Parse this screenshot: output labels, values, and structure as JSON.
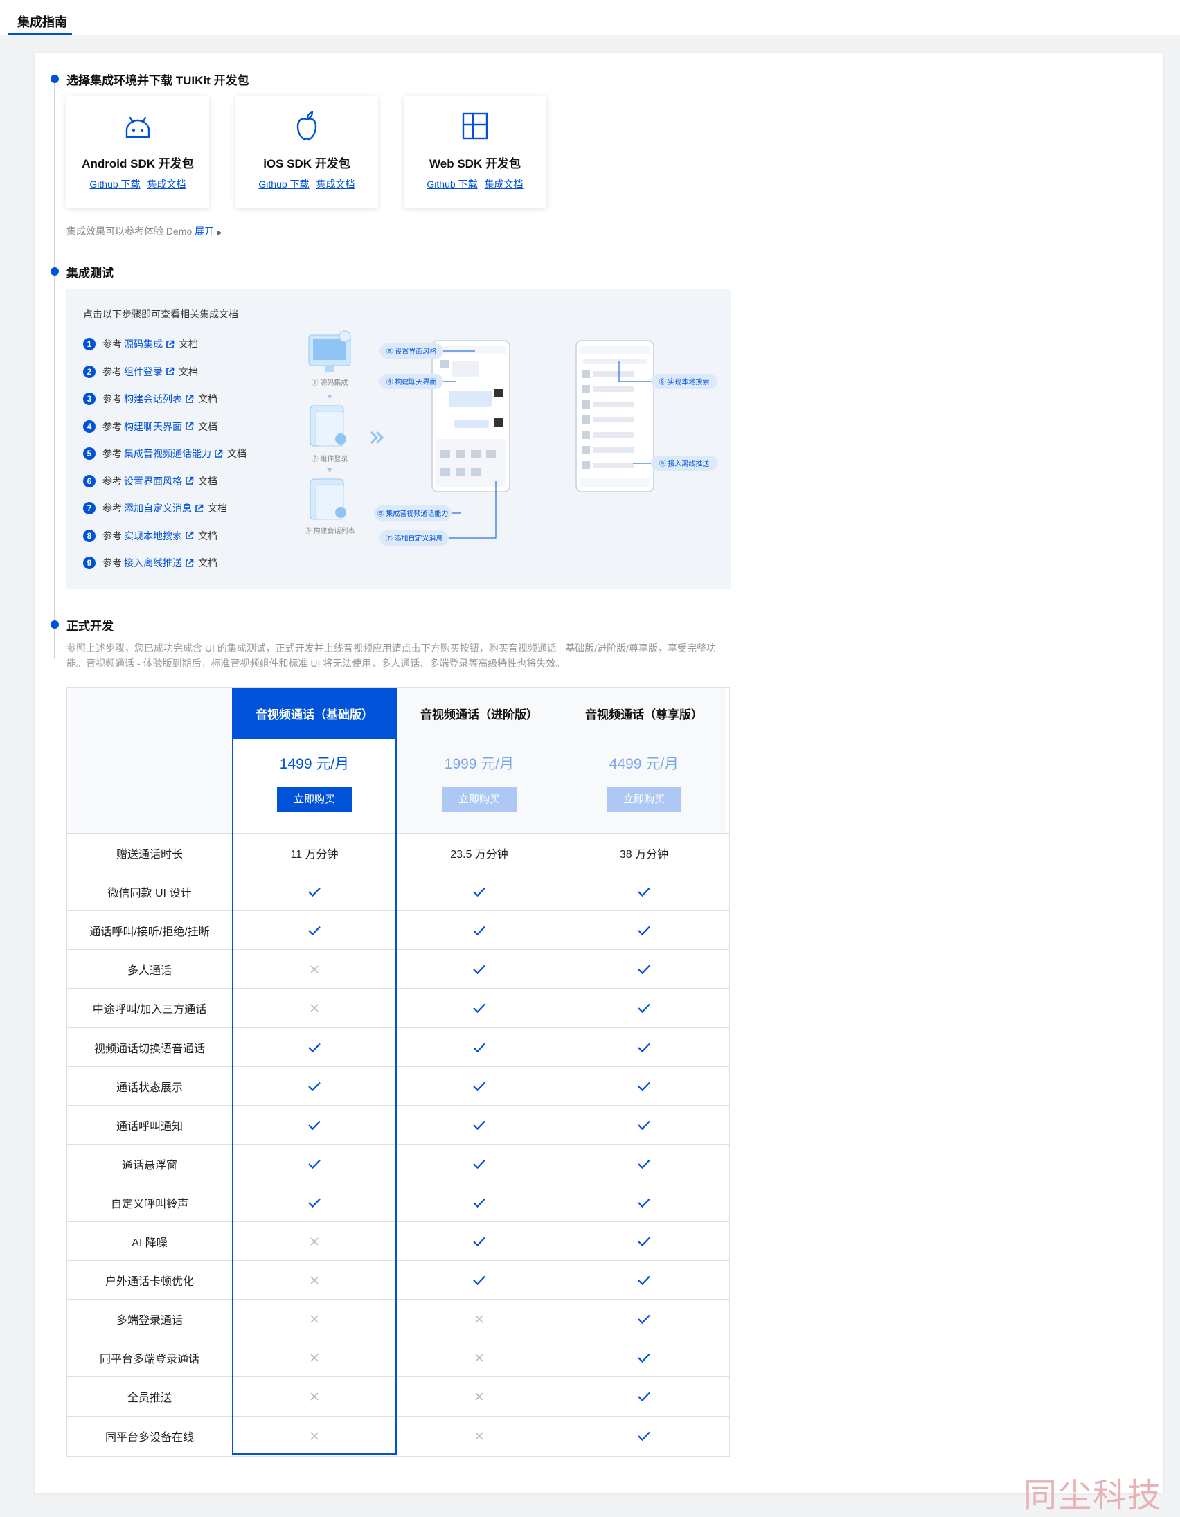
{
  "tab": "集成指南",
  "sections": {
    "s1": "选择集成环境并下载 TUIKit 开发包",
    "s2": "集成测试",
    "s3": "正式开发"
  },
  "sdks": [
    {
      "name": "Android SDK 开发包",
      "icon": "android-icon",
      "github": "Github 下载",
      "docs": "集成文档"
    },
    {
      "name": "iOS SDK 开发包",
      "icon": "apple-icon",
      "github": "Github 下载",
      "docs": "集成文档"
    },
    {
      "name": "Web SDK 开发包",
      "icon": "windows-icon",
      "github": "Github 下载",
      "docs": "集成文档"
    }
  ],
  "demo_note": "集成效果可以参考体验 Demo",
  "demo_expand": "展开",
  "guide": {
    "header": "点击以下步骤即可查看相关集成文档",
    "prefix": "参考",
    "suffix": "文档",
    "steps": [
      {
        "n": "1",
        "link": "源码集成"
      },
      {
        "n": "2",
        "link": "组件登录"
      },
      {
        "n": "3",
        "link": "构建会话列表"
      },
      {
        "n": "4",
        "link": "构建聊天界面"
      },
      {
        "n": "5",
        "link": "集成音视频通话能力"
      },
      {
        "n": "6",
        "link": "设置界面风格"
      },
      {
        "n": "7",
        "link": "添加自定义消息"
      },
      {
        "n": "8",
        "link": "实现本地搜索"
      },
      {
        "n": "9",
        "link": "接入离线推送"
      }
    ],
    "diagram_labels": {
      "a": "① 源码集成",
      "b": "② 组件登录",
      "c": "③ 构建会话列表",
      "d": "⑥ 设置界面风格",
      "e": "④ 构建聊天界面",
      "f": "⑤ 集成音视频通话能力",
      "g": "⑦ 添加自定义消息",
      "h": "⑧ 实现本地搜索",
      "i": "⑨ 接入离线推送"
    }
  },
  "description": "参照上述步骤，您已成功完成含 UI 的集成测试，正式开发并上线音视频应用请点击下方购买按钮，购买音视频通话 - 基础版/进阶版/尊享版，享受完整功能。音视频通话 - 体验版到期后，标准音视频组件和标准 UI 将无法使用，多人通话、多端登录等高级特性也将失效。",
  "plans": [
    {
      "name": "音视频通话（基础版）",
      "price": "1499 元/月",
      "buy": "立即购买",
      "active": true
    },
    {
      "name": "音视频通话（进阶版）",
      "price": "1999 元/月",
      "buy": "立即购买",
      "active": false
    },
    {
      "name": "音视频通话（尊享版）",
      "price": "4499 元/月",
      "buy": "立即购买",
      "active": false
    }
  ],
  "features": [
    {
      "name": "赠送通话时长",
      "values": [
        "11 万分钟",
        "23.5 万分钟",
        "38 万分钟"
      ]
    },
    {
      "name": "微信同款 UI 设计",
      "values": [
        true,
        true,
        true
      ]
    },
    {
      "name": "通话呼叫/接听/拒绝/挂断",
      "values": [
        true,
        true,
        true
      ]
    },
    {
      "name": "多人通话",
      "values": [
        false,
        true,
        true
      ]
    },
    {
      "name": "中途呼叫/加入三方通话",
      "values": [
        false,
        true,
        true
      ]
    },
    {
      "name": "视频通话切换语音通话",
      "values": [
        true,
        true,
        true
      ]
    },
    {
      "name": "通话状态展示",
      "values": [
        true,
        true,
        true
      ]
    },
    {
      "name": "通话呼叫通知",
      "values": [
        true,
        true,
        true
      ]
    },
    {
      "name": "通话悬浮窗",
      "values": [
        true,
        true,
        true
      ]
    },
    {
      "name": "自定义呼叫铃声",
      "values": [
        true,
        true,
        true
      ]
    },
    {
      "name": "AI 降噪",
      "values": [
        false,
        true,
        true
      ]
    },
    {
      "name": "户外通话卡顿优化",
      "values": [
        false,
        true,
        true
      ]
    },
    {
      "name": "多端登录通话",
      "values": [
        false,
        false,
        true
      ]
    },
    {
      "name": "同平台多端登录通话",
      "values": [
        false,
        false,
        true
      ]
    },
    {
      "name": "全员推送",
      "values": [
        false,
        false,
        true
      ]
    },
    {
      "name": "同平台多设备在线",
      "values": [
        false,
        false,
        true
      ]
    }
  ],
  "colors": {
    "accent": "#0052d9",
    "check": "#0052d9",
    "cross": "#b8bcc3",
    "price_active": "#0052d9",
    "price_inactive": "#7aa6ea"
  },
  "watermark": "同尘科技"
}
